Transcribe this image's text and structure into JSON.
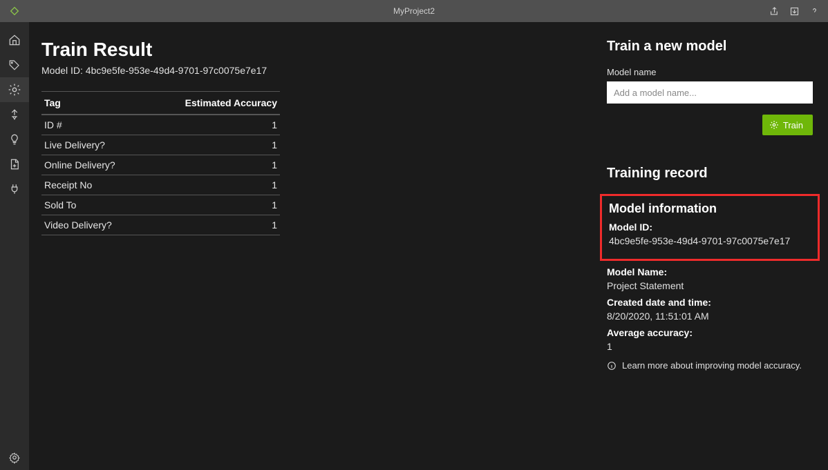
{
  "titlebar": {
    "title": "MyProject2"
  },
  "main": {
    "heading": "Train Result",
    "model_id_line": "Model ID: 4bc9e5fe-953e-49d4-9701-97c0075e7e17",
    "table": {
      "col_tag": "Tag",
      "col_accuracy": "Estimated Accuracy",
      "rows": [
        {
          "tag": "ID #",
          "accuracy": "1"
        },
        {
          "tag": "Live Delivery?",
          "accuracy": "1"
        },
        {
          "tag": "Online Delivery?",
          "accuracy": "1"
        },
        {
          "tag": "Receipt No",
          "accuracy": "1"
        },
        {
          "tag": "Sold To",
          "accuracy": "1"
        },
        {
          "tag": "Video Delivery?",
          "accuracy": "1"
        }
      ]
    }
  },
  "right": {
    "train_heading": "Train a new model",
    "model_name_label": "Model name",
    "model_name_placeholder": "Add a model name...",
    "train_button": "Train",
    "record_heading": "Training record",
    "info_heading": "Model information",
    "model_id_label": "Model ID:",
    "model_id_value": "4bc9e5fe-953e-49d4-9701-97c0075e7e17",
    "model_name_label2": "Model Name:",
    "model_name_value": "Project Statement",
    "created_label": "Created date and time:",
    "created_value": "8/20/2020, 11:51:01 AM",
    "avg_label": "Average accuracy:",
    "avg_value": "1",
    "learn_more": "Learn more about improving model accuracy."
  }
}
